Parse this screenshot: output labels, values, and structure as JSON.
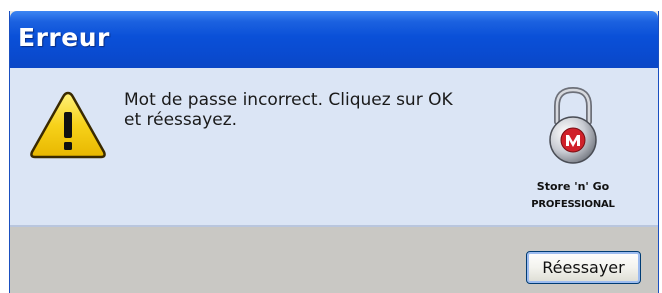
{
  "window": {
    "title": "Erreur"
  },
  "message": {
    "line1": "Mot de passe incorrect. Cliquez sur OK",
    "line2": "et réessayez."
  },
  "brand": {
    "name": "Store 'n' Go",
    "tagline": "PROFESSIONAL"
  },
  "buttons": {
    "retry_label": "Réessayer"
  },
  "icons": {
    "warning": "warning-icon",
    "lock": "padlock-icon"
  },
  "colors": {
    "titlebar": "#0a50d8",
    "content_bg": "#dbe5f5",
    "footer_bg": "#c9c8c4",
    "warning_yellow": "#f7d21a",
    "brand_red": "#d0212a"
  }
}
